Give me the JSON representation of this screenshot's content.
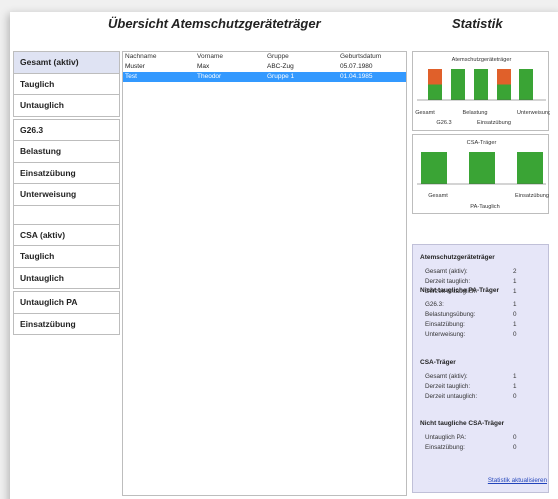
{
  "titles": {
    "main": "Übersicht Atemschutzgeräteträger",
    "stats": "Statistik"
  },
  "nav": {
    "group1": [
      "Gesamt (aktiv)",
      "Tauglich",
      "Untauglich"
    ],
    "group2": [
      "G26.3",
      "Belastung",
      "Einsatzübung",
      "Unterweisung"
    ],
    "group3": [
      "CSA (aktiv)",
      "Tauglich",
      "Untauglich"
    ],
    "group4": [
      "Untauglich PA",
      "Einsatzübung"
    ]
  },
  "table": {
    "headers": [
      "Nachname",
      "Vorname",
      "Gruppe",
      "Geburtsdatum"
    ],
    "rows": [
      [
        "Muster",
        "Max",
        "ABC-Zug",
        "05.07.1980"
      ],
      [
        "Test",
        "Theodor",
        "Gruppe 1",
        "01.04.1985"
      ]
    ]
  },
  "colors": {
    "bar_green": "#3aa435",
    "bar_orange": "#e0602a",
    "selection_blue": "#3399ff",
    "stats_bg": "#e6e6f8",
    "link_blue": "#2244bb"
  },
  "chart_data": [
    {
      "type": "bar",
      "title": "Atemschutzgeräteträger",
      "categories": [
        "Gesamt",
        "G26.3",
        "Belastung",
        "Einsatzübung",
        "Unterweisung"
      ],
      "series": [
        {
          "values": [
            1,
            2,
            2,
            1,
            2
          ]
        },
        {
          "values": [
            1,
            0,
            0,
            1,
            0
          ]
        }
      ],
      "stacked": true,
      "ylim": [
        0,
        2
      ]
    },
    {
      "type": "bar",
      "title": "CSA-Träger",
      "categories": [
        "Gesamt",
        "PA-Tauglich",
        "Einsatzübung"
      ],
      "series": [
        {
          "values": [
            1,
            1,
            1
          ]
        }
      ],
      "ylim": [
        0,
        1
      ]
    }
  ],
  "stats": {
    "sec1": {
      "title": "Atemschutzgeräteträger",
      "rows": [
        [
          "Gesamt (aktiv):",
          "2"
        ],
        [
          "Derzeit tauglich:",
          "1"
        ],
        [
          "Derzeit untauglich:",
          "1"
        ]
      ]
    },
    "sec2": {
      "title": "Nicht taugliche PA-Träger",
      "rows": [
        [
          "G26.3:",
          "1"
        ],
        [
          "Belastungsübung:",
          "0"
        ],
        [
          "Einsatzübung:",
          "1"
        ],
        [
          "Unterweisung:",
          "0"
        ]
      ]
    },
    "sec3": {
      "title": "CSA-Träger",
      "rows": [
        [
          "Gesamt (aktiv):",
          "1"
        ],
        [
          "Derzeit tauglich:",
          "1"
        ],
        [
          "Derzeit untauglich:",
          "0"
        ]
      ]
    },
    "sec4": {
      "title": "Nicht taugliche CSA-Träger",
      "rows": [
        [
          "Untauglich PA:",
          "0"
        ],
        [
          "Einsatzübung:",
          "0"
        ]
      ]
    },
    "link": "Statistik aktualisieren"
  }
}
